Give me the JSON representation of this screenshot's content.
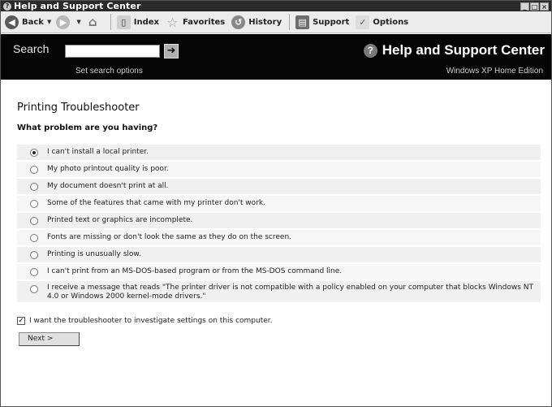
{
  "window": {
    "title": "Help and Support Center",
    "app_icon": "help-app-icon",
    "controls": [
      "minimize-icon",
      "maximize-icon",
      "close-icon"
    ]
  },
  "toolbar": {
    "back_label": "Back",
    "index_label": "Index",
    "favorites_label": "Favorites",
    "history_label": "History",
    "support_label": "Support",
    "options_label": "Options",
    "icons": [
      "back-arrow-icon",
      "forward-arrow-icon",
      "home-icon",
      "index-book-icon",
      "favorites-star-icon",
      "history-clock-icon",
      "support-icon",
      "options-icon"
    ]
  },
  "header": {
    "search_label": "Search",
    "search_value": "",
    "search_options_label": "Set search options",
    "title": "Help and Support Center",
    "edition": "Windows XP Home Edition"
  },
  "main": {
    "page_title": "Printing Troubleshooter",
    "question": "What problem are you having?",
    "options": [
      {
        "label": "I can't install a local printer.",
        "selected": true
      },
      {
        "label": "My photo printout quality is poor.",
        "selected": false
      },
      {
        "label": "My document doesn't print at all.",
        "selected": false
      },
      {
        "label": "Some of the features that came with my printer don't work.",
        "selected": false
      },
      {
        "label": "Printed text or graphics are incomplete.",
        "selected": false
      },
      {
        "label": "Fonts are missing or don't look the same as they do on the screen.",
        "selected": false
      },
      {
        "label": "Printing is unusually slow.",
        "selected": false
      },
      {
        "label": "I can't print from an MS-DOS-based program or from the MS-DOS command line.",
        "selected": false
      },
      {
        "label": "I receive a message that reads \"The printer driver is not compatible with a policy enabled on your computer that blocks Windows NT 4.0 or Windows 2000 kernel-mode drivers.\"",
        "selected": false
      }
    ],
    "investigate_label": "I want the troubleshooter to investigate settings on this computer.",
    "investigate_checked": true,
    "next_label": "Next  >"
  }
}
